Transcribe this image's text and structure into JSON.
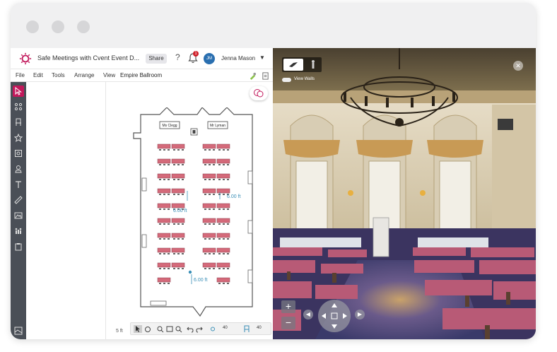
{
  "app": {
    "title": "Safe Meetings with Cvent Event D...",
    "share_label": "Share",
    "help_label": "?",
    "notification_count": "1",
    "user_initials": "JM",
    "user_name": "Jenna Mason",
    "caret": "▼"
  },
  "menu": {
    "items": [
      "File",
      "Edit",
      "Tools",
      "Arrange",
      "View"
    ],
    "room_name": "Empire Ballroom"
  },
  "toolbar": {
    "icons": [
      "select-arrow-icon",
      "nodes-icon",
      "chair-icon",
      "star-icon",
      "image-layer-icon",
      "stamp-icon",
      "text-icon",
      "ruler-icon",
      "picture-icon",
      "people-icon",
      "clipboard-icon",
      "map-icon"
    ]
  },
  "plan": {
    "labels": {
      "left_head": "Ms Clegg",
      "right_head": "Mr Lyman"
    },
    "measurements": [
      "6.00 ft",
      "6.00 ft",
      "6.00 ft"
    ],
    "scale": "5 ft"
  },
  "bottombar": {
    "value_a": "40",
    "value_b": "40"
  },
  "view3d": {
    "view_walls_label": "View Walls",
    "close_label": "✕",
    "zoom_in": "+",
    "zoom_out": "−"
  },
  "colors": {
    "accent": "#c2185b",
    "toolbar_bg": "#4a4f57",
    "table": "#d46a7a"
  }
}
